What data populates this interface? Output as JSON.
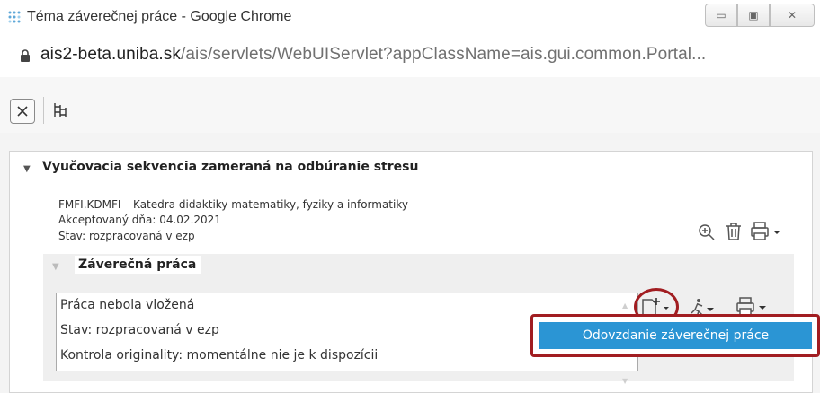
{
  "window": {
    "title": "Téma záverečnej práce - Google Chrome",
    "controls": {
      "minimize": "▭",
      "maximize": "▣",
      "close": "✕"
    }
  },
  "address": {
    "host": "ais2-beta.uniba.sk",
    "path": "/ais/servlets/WebUIServlet?appClassName=ais.gui.common.Portal..."
  },
  "toolbar": {
    "close_icon": "close-icon",
    "tree_icon": "hierarchy-icon"
  },
  "sequence": {
    "title": "Vyučovacia sekvencia zameraná na odbúranie stresu",
    "department": "FMFI.KDMFI – Katedra didaktiky matematiky, fyziky a informatiky",
    "accepted": "Akceptovaný dňa: 04.02.2021",
    "status": "Stav: rozpracovaná v ezp"
  },
  "thesis": {
    "title": "Záverečná práca",
    "lines": [
      "Práca nebola vložená",
      "Stav: rozpracovaná v ezp",
      "Kontrola originality: momentálne nie je k dispozícii"
    ]
  },
  "dropdown": {
    "item": "Odovzdanie záverečnej práce"
  },
  "colors": {
    "highlight": "#a11d21",
    "popup_selected": "#2b95d4"
  }
}
